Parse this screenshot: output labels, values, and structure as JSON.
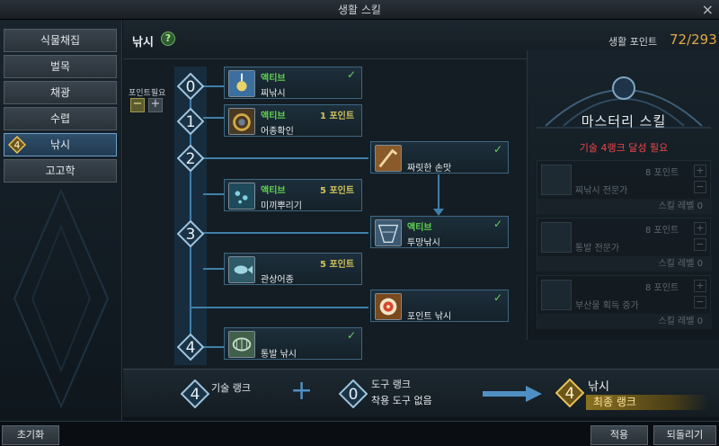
{
  "window": {
    "title": "생활 스킬",
    "close": "×"
  },
  "sidebar": {
    "items": [
      {
        "label": "식물채집"
      },
      {
        "label": "벌목"
      },
      {
        "label": "채광"
      },
      {
        "label": "수렵"
      },
      {
        "label": "낚시",
        "badge": "4",
        "active": true
      },
      {
        "label": "고고학"
      }
    ]
  },
  "header": {
    "title": "낚시",
    "help": "?",
    "points_label": "생활 포인트",
    "points_value": "72/293"
  },
  "points_required": {
    "label": "포인트필요",
    "minus": "−",
    "plus": "+"
  },
  "tree": {
    "ranks": [
      "0",
      "1",
      "2",
      "3",
      "4"
    ],
    "nodes": [
      {
        "tag": "액티브",
        "points": "",
        "name": "찌낚시",
        "learned": true,
        "check": "✓"
      },
      {
        "tag": "액티브",
        "points": "1 포인트",
        "name": "어종확인",
        "learned": false,
        "check": ""
      },
      {
        "tag": "",
        "points": "",
        "name": "짜릿한 손맛",
        "learned": true,
        "check": "✓"
      },
      {
        "tag": "액티브",
        "points": "5 포인트",
        "name": "미끼뿌리기",
        "learned": false,
        "check": ""
      },
      {
        "tag": "액티브",
        "points": "",
        "name": "투망낚시",
        "learned": true,
        "check": "✓"
      },
      {
        "tag": "",
        "points": "5 포인트",
        "name": "관상어종",
        "learned": false,
        "check": ""
      },
      {
        "tag": "",
        "points": "",
        "name": "포인트 낚시",
        "learned": true,
        "check": "✓"
      },
      {
        "tag": "",
        "points": "",
        "name": "통발 낚시",
        "learned": true,
        "check": "✓"
      }
    ]
  },
  "mastery": {
    "title": "마스터리 스킬",
    "requirement": "기술 4랭크 달성 필요",
    "skills": [
      {
        "points": "8 포인트",
        "name": "찌낚시 전문가",
        "level": "스킬 레벨 0",
        "plus": "+",
        "minus": "−"
      },
      {
        "points": "8 포인트",
        "name": "통발 전문가",
        "level": "스킬 레벨 0",
        "plus": "+",
        "minus": "−"
      },
      {
        "points": "8 포인트",
        "name": "부산물 획득 증가",
        "level": "스킬 레벨 0",
        "plus": "+",
        "minus": "−"
      }
    ]
  },
  "footer": {
    "skill_rank_value": "4",
    "skill_rank_label": "기술 랭크",
    "plus_sign": "+",
    "tool_rank_value": "0",
    "tool_rank_label": "도구 랭크",
    "tool_equipped": "착용 도구 없음",
    "final_value": "4",
    "final_name": "낚시",
    "final_label": "최종 랭크"
  },
  "bottom": {
    "reset": "초기화",
    "apply": "적용",
    "revert": "되돌리기"
  },
  "colors": {
    "accent": "#e0a94a",
    "active_tag": "#5fd14f",
    "points_tag": "#d3c45a",
    "warning": "#ee4646"
  }
}
